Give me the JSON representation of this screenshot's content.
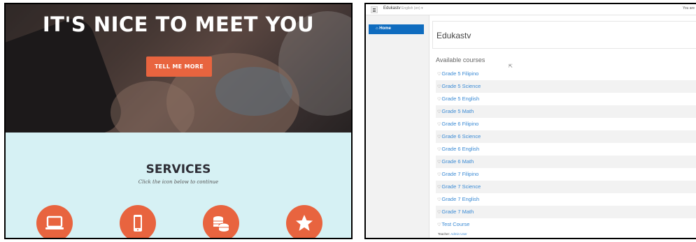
{
  "left": {
    "hero_title": "IT'S NICE TO MEET YOU",
    "cta_label": "TELL ME MORE",
    "services_title": "SERVICES",
    "services_subtitle": "Click the icon below to continue",
    "service_icons": [
      "laptop-icon",
      "tablet-icon",
      "coins-icon",
      "star-icon"
    ],
    "colors": {
      "accent": "#e8643f",
      "services_bg": "#d6f1f4",
      "heading": "#2d2d35"
    }
  },
  "right": {
    "navbar": {
      "brand": "Edukastv",
      "language": "English (en) ▾",
      "login_hint": "You are"
    },
    "sidebar": {
      "home_label": "Home"
    },
    "page_title": "Edukastv",
    "available_label": "Available courses",
    "courses": [
      "Grade 5 Filipino",
      "Grade 5 Science",
      "Grade 5 English",
      "Grade 5 Math",
      "Grade 6 Filipino",
      "Grade 6 Science",
      "Grade 6 English",
      "Grade 6 Math",
      "Grade 7 Filipino",
      "Grade 7 Science",
      "Grade 7 English",
      "Grade 7 Math",
      "Test Course"
    ],
    "teacher_label": "Teacher:",
    "teacher_name": "Admin User",
    "colors": {
      "primary": "#0f6cbf",
      "link": "#3a8ad4",
      "stripe": "#f2f2f2"
    }
  }
}
